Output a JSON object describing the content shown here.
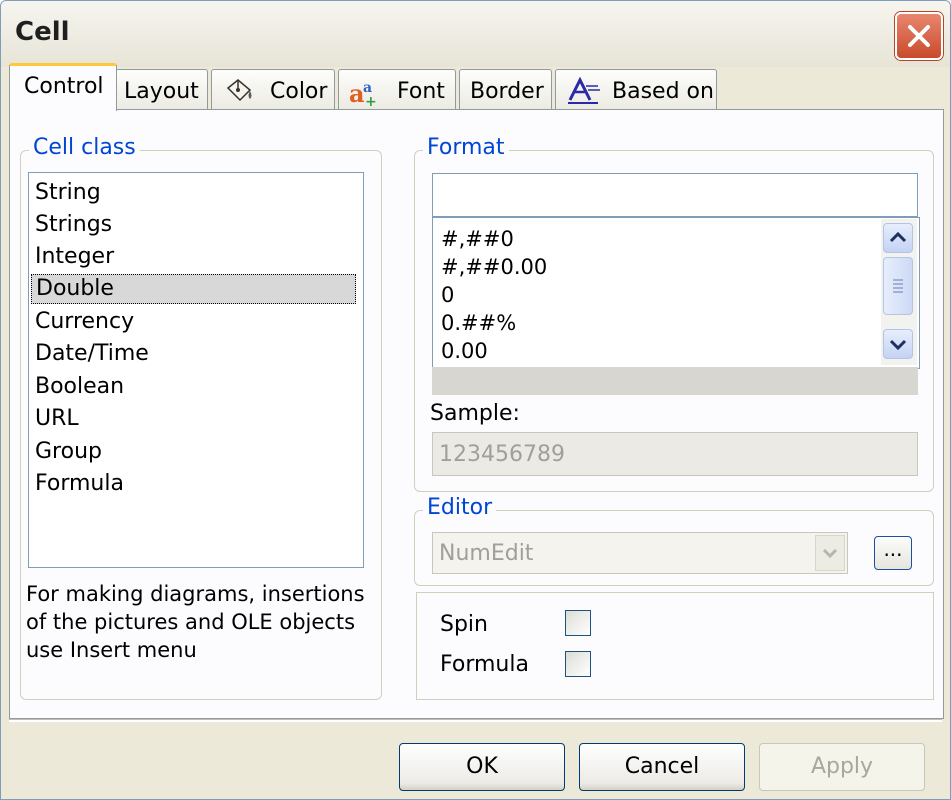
{
  "window": {
    "title": "Cell",
    "close_icon": "close-icon"
  },
  "tabs": [
    {
      "label": "Control",
      "icon": null,
      "active": true
    },
    {
      "label": "Layout",
      "icon": null,
      "active": false
    },
    {
      "label": "Color",
      "icon": "paint-bucket-icon",
      "active": false
    },
    {
      "label": "Font",
      "icon": "font-icon",
      "active": false
    },
    {
      "label": "Border",
      "icon": null,
      "active": false
    },
    {
      "label": "Based on",
      "icon": "style-icon",
      "active": false
    }
  ],
  "cell_class": {
    "label": "Cell class",
    "items": [
      "String",
      "Strings",
      "Integer",
      "Double",
      "Currency",
      "Date/Time",
      "Boolean",
      "URL",
      "Group",
      "Formula"
    ],
    "selected": "Double"
  },
  "note": "For making diagrams, insertions of the pictures and OLE  objects use Insert menu",
  "format": {
    "label": "Format",
    "value": "",
    "items": [
      "#,##0",
      "#,##0.00",
      "0",
      "0.##%",
      "0.00"
    ],
    "sample_label": "Sample:",
    "sample_value": "123456789"
  },
  "editor": {
    "label": "Editor",
    "value": "NumEdit",
    "browse_label": "..."
  },
  "options": {
    "spin_label": "Spin",
    "spin_checked": false,
    "formula_label": "Formula",
    "formula_checked": false
  },
  "buttons": {
    "ok": "OK",
    "cancel": "Cancel",
    "apply": "Apply"
  },
  "colors": {
    "group_label": "#0046d5",
    "active_tab_accent": "#ffc83c",
    "close_button": "#c94a2b"
  }
}
